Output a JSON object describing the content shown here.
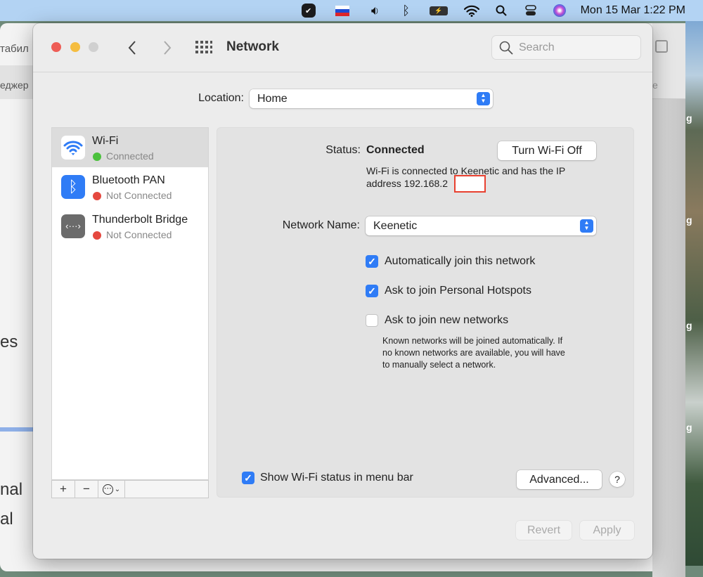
{
  "menubar": {
    "icons": [
      "checkmark-app-icon",
      "russian-flag-icon",
      "volume-icon",
      "bluetooth-icon",
      "battery-charging-icon",
      "wifi-icon",
      "spotlight-search-icon",
      "control-center-icon",
      "siri-icon"
    ],
    "clock": "Mon 15 Mar  1:22 PM"
  },
  "background_window": {
    "fragments": [
      "табил",
      "еджер",
      "es",
      "nal",
      "al",
      "e",
      "g",
      "g",
      "g",
      "g"
    ]
  },
  "window": {
    "title": "Network",
    "search_placeholder": "Search",
    "location": {
      "label": "Location:",
      "value": "Home"
    },
    "services": [
      {
        "name": "Wi-Fi",
        "status": "Connected",
        "status_color": "#4cc13d",
        "icon": "wifi-icon",
        "selected": true
      },
      {
        "name": "Bluetooth PAN",
        "status": "Not Connected",
        "status_color": "#e5483f",
        "icon": "bluetooth-icon",
        "selected": false
      },
      {
        "name": "Thunderbolt Bridge",
        "status": "Not Connected",
        "status_color": "#e5483f",
        "icon": "thunderbolt-bridge-icon",
        "selected": false
      }
    ],
    "sidebar_tools": {
      "add": "+",
      "remove": "−",
      "actions": "⋯"
    },
    "detail": {
      "status_label": "Status:",
      "status_value": "Connected",
      "turn_off_button": "Turn Wi-Fi Off",
      "description_line1": "Wi-Fi is connected to Keenetic and has the IP",
      "description_line2": "address 192.168.2",
      "network_name_label": "Network Name:",
      "network_name_value": "Keenetic",
      "options": [
        {
          "label": "Automatically join this network",
          "checked": true
        },
        {
          "label": "Ask to join Personal Hotspots",
          "checked": true
        },
        {
          "label": "Ask to join new networks",
          "checked": false
        }
      ],
      "note": [
        "Known networks will be joined automatically. If",
        "no known networks are available, you will have",
        "to manually select a network."
      ],
      "show_status": {
        "label": "Show Wi-Fi status in menu bar",
        "checked": true
      },
      "advanced_button": "Advanced...",
      "help_button": "?"
    },
    "revert_button": "Revert",
    "apply_button": "Apply"
  },
  "colors": {
    "accent": "#2f7cf6",
    "redaction": "#e8402f"
  }
}
